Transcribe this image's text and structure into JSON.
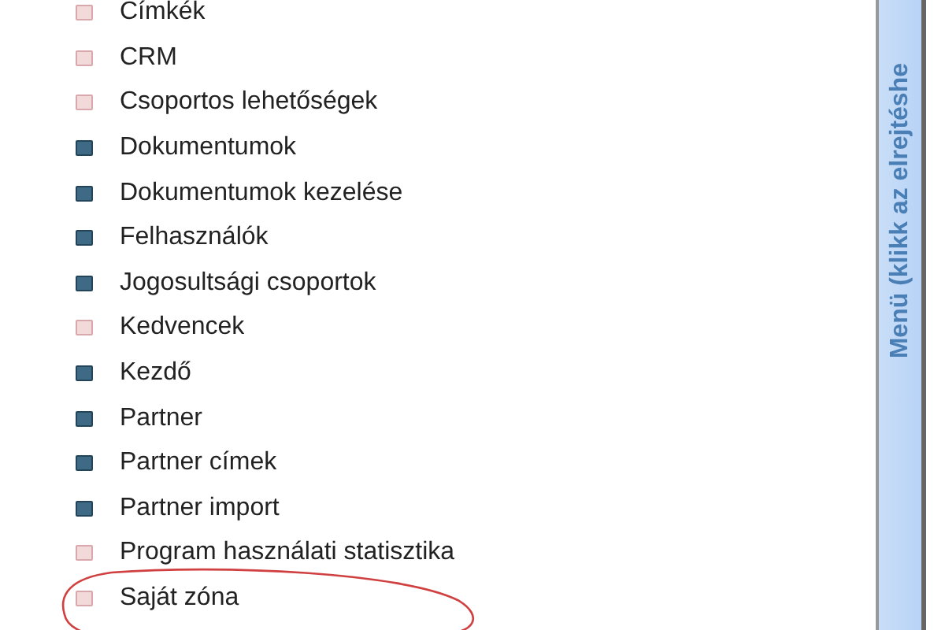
{
  "menu_items": [
    {
      "label": "Címkék",
      "kind": "light",
      "circled": false
    },
    {
      "label": "CRM",
      "kind": "light",
      "circled": false
    },
    {
      "label": "Csoportos lehetőségek",
      "kind": "light",
      "circled": false
    },
    {
      "label": "Dokumentumok",
      "kind": "dark",
      "circled": false
    },
    {
      "label": "Dokumentumok kezelése",
      "kind": "dark",
      "circled": false
    },
    {
      "label": "Felhasználók",
      "kind": "dark",
      "circled": false
    },
    {
      "label": "Jogosultsági csoportok",
      "kind": "dark",
      "circled": false
    },
    {
      "label": "Kedvencek",
      "kind": "light",
      "circled": false
    },
    {
      "label": "Kezdő",
      "kind": "dark",
      "circled": false
    },
    {
      "label": "Partner",
      "kind": "dark",
      "circled": false
    },
    {
      "label": "Partner címek",
      "kind": "dark",
      "circled": false
    },
    {
      "label": "Partner import",
      "kind": "dark",
      "circled": false
    },
    {
      "label": "Program használati statisztika",
      "kind": "light",
      "circled": false
    },
    {
      "label": "Saját zóna",
      "kind": "light",
      "circled": true
    }
  ],
  "side_bar": {
    "label": "Menü (klikk az elrejtéshe"
  }
}
